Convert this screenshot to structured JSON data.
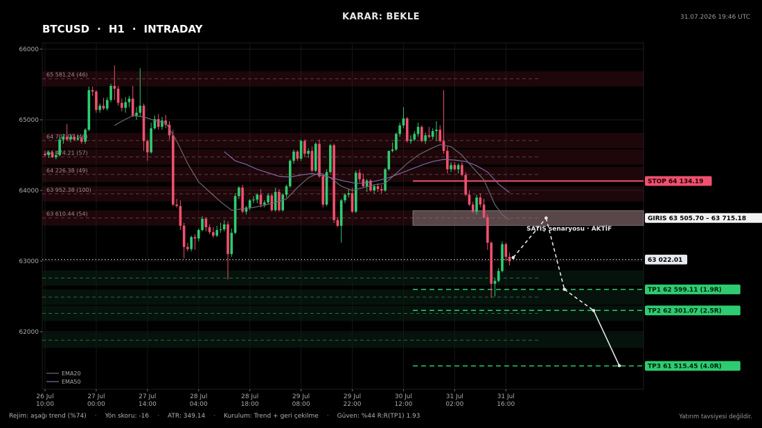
{
  "header": {
    "decision": "KARAR: BEKLE",
    "symbol": "BTCUSD",
    "timeframe": "H1",
    "mode": "INTRADAY",
    "separator": "·",
    "timestamp": "31.07.2026 19:46 UTC"
  },
  "footer": {
    "regime": "Rejim: aşağı trend (%74)",
    "direction": "Yön skoru: -16",
    "atr": "ATR: 349.14",
    "setup": "Kurulum: Trend + geri çekilme",
    "confidence": "Güven: %44   R:R(TP1) 1.93",
    "separator": "·",
    "disclaimer": "Yatırım tavsiyesi değildir."
  },
  "chart_data": {
    "type": "candlestick",
    "y_ticks": [
      62000,
      63000,
      64000,
      65000,
      66000
    ],
    "ylim": [
      61150,
      66100
    ],
    "x_ticks": [
      {
        "index": 0,
        "label": "26 Jul\n10:00"
      },
      {
        "index": 14,
        "label": "27 Jul\n00:00"
      },
      {
        "index": 28,
        "label": "27 Jul\n14:00"
      },
      {
        "index": 42,
        "label": "28 Jul\n04:00"
      },
      {
        "index": 56,
        "label": "28 Jul\n18:00"
      },
      {
        "index": 70,
        "label": "29 Jul\n08:00"
      },
      {
        "index": 84,
        "label": "29 Jul\n22:00"
      },
      {
        "index": 98,
        "label": "30 Jul\n12:00"
      },
      {
        "index": 112,
        "label": "31 Jul\n02:00"
      },
      {
        "index": 126,
        "label": "31 Jul\n16:00"
      }
    ],
    "colors": {
      "up": "#2ecc71",
      "down": "#f0506e",
      "ema20": "#6a6a72",
      "ema50": "#7a6aa0"
    },
    "legend": [
      {
        "name": "EMA20",
        "color": "#6a6a72"
      },
      {
        "name": "EMA50",
        "color": "#7a6aa0"
      }
    ],
    "resistance_levels": [
      {
        "price": 65581.24,
        "label": "65 581.24  (46)"
      },
      {
        "price": 64707.0,
        "label": "64 707.00  (46)"
      },
      {
        "price": 64474.21,
        "label": "64 474.21  (57)"
      },
      {
        "price": 64226.38,
        "label": "64 226.38  (49)"
      },
      {
        "price": 63952.38,
        "label": "63 952.38  (100)"
      },
      {
        "price": 63610.44,
        "label": "63 610.44  (54)"
      }
    ],
    "support_levels": [
      62760,
      62490,
      62260,
      61880
    ],
    "trade": {
      "scenario_label": "SATIŞ senaryosu  ·  AKTİF",
      "stop": {
        "price": 64134.19,
        "label": "STOP  64 134.19"
      },
      "entry": {
        "low": 63505.7,
        "high": 63715.18,
        "label": "GIRIS  63 505.70 – 63 715.18"
      },
      "current": {
        "price": 63022.01,
        "label": "63 022.01"
      },
      "targets": [
        {
          "price": 62599.11,
          "label": "TP1  62 599.11  (1.9R)"
        },
        {
          "price": 62301.07,
          "label": "TP2  62 301.07  (2.5R)"
        },
        {
          "price": 61515.45,
          "label": "TP3  61 515.45  (4.0R)"
        }
      ],
      "path": [
        {
          "index": 128,
          "price": 63050
        },
        {
          "index": 137,
          "price": 63610
        },
        {
          "index": 142,
          "price": 62600
        },
        {
          "index": 150,
          "price": 62300
        },
        {
          "index": 157,
          "price": 61520
        }
      ]
    },
    "candles": [
      {
        "o": 64520,
        "h": 64560,
        "l": 64480,
        "c": 64500
      },
      {
        "o": 64500,
        "h": 64560,
        "l": 64460,
        "c": 64540
      },
      {
        "o": 64540,
        "h": 64570,
        "l": 64460,
        "c": 64470
      },
      {
        "o": 64470,
        "h": 64560,
        "l": 64440,
        "c": 64500
      },
      {
        "o": 64500,
        "h": 64760,
        "l": 64480,
        "c": 64720
      },
      {
        "o": 64720,
        "h": 64800,
        "l": 64660,
        "c": 64760
      },
      {
        "o": 64760,
        "h": 64940,
        "l": 64700,
        "c": 64720
      },
      {
        "o": 64720,
        "h": 64800,
        "l": 64680,
        "c": 64760
      },
      {
        "o": 64760,
        "h": 64800,
        "l": 64700,
        "c": 64720
      },
      {
        "o": 64720,
        "h": 64790,
        "l": 64700,
        "c": 64740
      },
      {
        "o": 64740,
        "h": 64760,
        "l": 64660,
        "c": 64690
      },
      {
        "o": 64690,
        "h": 64880,
        "l": 64660,
        "c": 64860
      },
      {
        "o": 64860,
        "h": 65470,
        "l": 64840,
        "c": 65420
      },
      {
        "o": 65420,
        "h": 65470,
        "l": 65340,
        "c": 65400
      },
      {
        "o": 65400,
        "h": 65420,
        "l": 65100,
        "c": 65140
      },
      {
        "o": 65140,
        "h": 65230,
        "l": 65100,
        "c": 65200
      },
      {
        "o": 65200,
        "h": 65310,
        "l": 65140,
        "c": 65160
      },
      {
        "o": 65160,
        "h": 65320,
        "l": 65130,
        "c": 65280
      },
      {
        "o": 65280,
        "h": 65510,
        "l": 65250,
        "c": 65480
      },
      {
        "o": 65480,
        "h": 65770,
        "l": 65280,
        "c": 65440
      },
      {
        "o": 65440,
        "h": 65480,
        "l": 65200,
        "c": 65240
      },
      {
        "o": 65240,
        "h": 65300,
        "l": 65120,
        "c": 65170
      },
      {
        "o": 65170,
        "h": 65320,
        "l": 65100,
        "c": 65250
      },
      {
        "o": 65250,
        "h": 65340,
        "l": 65180,
        "c": 65300
      },
      {
        "o": 65300,
        "h": 65480,
        "l": 65040,
        "c": 65060
      },
      {
        "o": 65060,
        "h": 65180,
        "l": 65000,
        "c": 65100
      },
      {
        "o": 65100,
        "h": 65730,
        "l": 65040,
        "c": 65200
      },
      {
        "o": 65200,
        "h": 65230,
        "l": 64560,
        "c": 64700
      },
      {
        "o": 64700,
        "h": 64720,
        "l": 64420,
        "c": 64540
      },
      {
        "o": 64540,
        "h": 64960,
        "l": 64520,
        "c": 64880
      },
      {
        "o": 64880,
        "h": 65060,
        "l": 64860,
        "c": 65010
      },
      {
        "o": 65010,
        "h": 65080,
        "l": 64860,
        "c": 64900
      },
      {
        "o": 64900,
        "h": 65040,
        "l": 64860,
        "c": 64990
      },
      {
        "o": 64990,
        "h": 65070,
        "l": 64880,
        "c": 64930
      },
      {
        "o": 64930,
        "h": 64980,
        "l": 64720,
        "c": 64780
      },
      {
        "o": 64780,
        "h": 64860,
        "l": 63780,
        "c": 63800
      },
      {
        "o": 63800,
        "h": 63880,
        "l": 63760,
        "c": 63780
      },
      {
        "o": 63780,
        "h": 63860,
        "l": 63440,
        "c": 63500
      },
      {
        "o": 63500,
        "h": 63540,
        "l": 63040,
        "c": 63200
      },
      {
        "o": 63200,
        "h": 63260,
        "l": 63140,
        "c": 63170
      },
      {
        "o": 63170,
        "h": 63360,
        "l": 63140,
        "c": 63340
      },
      {
        "o": 63340,
        "h": 63380,
        "l": 63160,
        "c": 63320
      },
      {
        "o": 63320,
        "h": 63460,
        "l": 63280,
        "c": 63440
      },
      {
        "o": 63440,
        "h": 63640,
        "l": 63420,
        "c": 63600
      },
      {
        "o": 63600,
        "h": 63620,
        "l": 63420,
        "c": 63480
      },
      {
        "o": 63480,
        "h": 63520,
        "l": 63380,
        "c": 63410
      },
      {
        "o": 63410,
        "h": 63480,
        "l": 63330,
        "c": 63360
      },
      {
        "o": 63360,
        "h": 63500,
        "l": 63340,
        "c": 63440
      },
      {
        "o": 63440,
        "h": 63540,
        "l": 63400,
        "c": 63450
      },
      {
        "o": 63450,
        "h": 63580,
        "l": 63420,
        "c": 63520
      },
      {
        "o": 63520,
        "h": 63560,
        "l": 62740,
        "c": 63100
      },
      {
        "o": 63100,
        "h": 63460,
        "l": 63060,
        "c": 63400
      },
      {
        "o": 63400,
        "h": 63960,
        "l": 63380,
        "c": 63920
      },
      {
        "o": 63920,
        "h": 64060,
        "l": 63880,
        "c": 64040
      },
      {
        "o": 64040,
        "h": 64080,
        "l": 63680,
        "c": 63700
      },
      {
        "o": 63700,
        "h": 63780,
        "l": 63660,
        "c": 63760
      },
      {
        "o": 63760,
        "h": 63880,
        "l": 63720,
        "c": 63860
      },
      {
        "o": 63860,
        "h": 63920,
        "l": 63820,
        "c": 63870
      },
      {
        "o": 63870,
        "h": 63960,
        "l": 63820,
        "c": 63940
      },
      {
        "o": 63940,
        "h": 64020,
        "l": 63760,
        "c": 63800
      },
      {
        "o": 63800,
        "h": 63860,
        "l": 63760,
        "c": 63830
      },
      {
        "o": 63830,
        "h": 63960,
        "l": 63800,
        "c": 63930
      },
      {
        "o": 63930,
        "h": 63960,
        "l": 63700,
        "c": 63720
      },
      {
        "o": 63720,
        "h": 64040,
        "l": 63700,
        "c": 63980
      },
      {
        "o": 63980,
        "h": 64020,
        "l": 63700,
        "c": 63720
      },
      {
        "o": 63720,
        "h": 63960,
        "l": 63700,
        "c": 63940
      },
      {
        "o": 63940,
        "h": 64080,
        "l": 63900,
        "c": 64060
      },
      {
        "o": 64060,
        "h": 64440,
        "l": 64040,
        "c": 64420
      },
      {
        "o": 64420,
        "h": 64580,
        "l": 64380,
        "c": 64550
      },
      {
        "o": 64550,
        "h": 64570,
        "l": 64420,
        "c": 64450
      },
      {
        "o": 64450,
        "h": 64720,
        "l": 64420,
        "c": 64700
      },
      {
        "o": 64700,
        "h": 64720,
        "l": 64480,
        "c": 64520
      },
      {
        "o": 64520,
        "h": 64600,
        "l": 64460,
        "c": 64560
      },
      {
        "o": 64560,
        "h": 64620,
        "l": 64260,
        "c": 64280
      },
      {
        "o": 64280,
        "h": 64680,
        "l": 64260,
        "c": 64660
      },
      {
        "o": 64660,
        "h": 64720,
        "l": 64180,
        "c": 64200
      },
      {
        "o": 64200,
        "h": 64240,
        "l": 63760,
        "c": 63800
      },
      {
        "o": 63800,
        "h": 64300,
        "l": 63780,
        "c": 64260
      },
      {
        "o": 64260,
        "h": 64660,
        "l": 64240,
        "c": 64640
      },
      {
        "o": 64640,
        "h": 64660,
        "l": 63540,
        "c": 63580
      },
      {
        "o": 63580,
        "h": 63620,
        "l": 63480,
        "c": 63500
      },
      {
        "o": 63500,
        "h": 63880,
        "l": 63260,
        "c": 63860
      },
      {
        "o": 63860,
        "h": 63960,
        "l": 63820,
        "c": 63940
      },
      {
        "o": 63940,
        "h": 64020,
        "l": 63900,
        "c": 63960
      },
      {
        "o": 63960,
        "h": 64040,
        "l": 63680,
        "c": 63700
      },
      {
        "o": 63700,
        "h": 64280,
        "l": 63680,
        "c": 64250
      },
      {
        "o": 64250,
        "h": 64300,
        "l": 64120,
        "c": 64160
      },
      {
        "o": 64160,
        "h": 64240,
        "l": 64040,
        "c": 64060
      },
      {
        "o": 64060,
        "h": 64160,
        "l": 63980,
        "c": 64140
      },
      {
        "o": 64140,
        "h": 64160,
        "l": 63980,
        "c": 64000
      },
      {
        "o": 64000,
        "h": 64080,
        "l": 63960,
        "c": 64060
      },
      {
        "o": 64060,
        "h": 64100,
        "l": 63980,
        "c": 64020
      },
      {
        "o": 64020,
        "h": 64080,
        "l": 63960,
        "c": 64000
      },
      {
        "o": 64000,
        "h": 64320,
        "l": 63980,
        "c": 64300
      },
      {
        "o": 64300,
        "h": 64560,
        "l": 64280,
        "c": 64560
      },
      {
        "o": 64560,
        "h": 64680,
        "l": 64540,
        "c": 64580
      },
      {
        "o": 64580,
        "h": 64820,
        "l": 64560,
        "c": 64800
      },
      {
        "o": 64800,
        "h": 64960,
        "l": 64760,
        "c": 64920
      },
      {
        "o": 64920,
        "h": 65180,
        "l": 64880,
        "c": 65020
      },
      {
        "o": 65020,
        "h": 65040,
        "l": 64680,
        "c": 64700
      },
      {
        "o": 64700,
        "h": 64780,
        "l": 64660,
        "c": 64720
      },
      {
        "o": 64720,
        "h": 64840,
        "l": 64700,
        "c": 64800
      },
      {
        "o": 64800,
        "h": 64960,
        "l": 64760,
        "c": 64900
      },
      {
        "o": 64900,
        "h": 64920,
        "l": 64680,
        "c": 64700
      },
      {
        "o": 64700,
        "h": 64820,
        "l": 64660,
        "c": 64780
      },
      {
        "o": 64780,
        "h": 64900,
        "l": 64740,
        "c": 64760
      },
      {
        "o": 64760,
        "h": 64880,
        "l": 64720,
        "c": 64840
      },
      {
        "o": 64840,
        "h": 64980,
        "l": 64700,
        "c": 64860
      },
      {
        "o": 64860,
        "h": 64920,
        "l": 64680,
        "c": 64700
      },
      {
        "o": 64700,
        "h": 65420,
        "l": 64520,
        "c": 64560
      },
      {
        "o": 64560,
        "h": 64620,
        "l": 64240,
        "c": 64300
      },
      {
        "o": 64300,
        "h": 64400,
        "l": 64260,
        "c": 64360
      },
      {
        "o": 64360,
        "h": 64400,
        "l": 64280,
        "c": 64300
      },
      {
        "o": 64300,
        "h": 64380,
        "l": 64240,
        "c": 64360
      },
      {
        "o": 64360,
        "h": 64400,
        "l": 64200,
        "c": 64220
      },
      {
        "o": 64220,
        "h": 64260,
        "l": 63920,
        "c": 63940
      },
      {
        "o": 63940,
        "h": 64000,
        "l": 63780,
        "c": 63800
      },
      {
        "o": 63800,
        "h": 63840,
        "l": 63680,
        "c": 63700
      },
      {
        "o": 63700,
        "h": 63940,
        "l": 63660,
        "c": 63900
      },
      {
        "o": 63900,
        "h": 63960,
        "l": 63760,
        "c": 63800
      },
      {
        "o": 63800,
        "h": 63880,
        "l": 63600,
        "c": 63620
      },
      {
        "o": 63620,
        "h": 63660,
        "l": 63160,
        "c": 63260
      },
      {
        "o": 63260,
        "h": 63280,
        "l": 62480,
        "c": 62680
      },
      {
        "o": 62680,
        "h": 62760,
        "l": 62500,
        "c": 62720
      },
      {
        "o": 62720,
        "h": 62900,
        "l": 62700,
        "c": 62860
      },
      {
        "o": 62860,
        "h": 63280,
        "l": 62840,
        "c": 63240
      },
      {
        "o": 63240,
        "h": 63260,
        "l": 63000,
        "c": 63060
      },
      {
        "o": 63060,
        "h": 63120,
        "l": 62940,
        "c": 63000
      }
    ],
    "ema20": [
      {
        "index": 19,
        "price": 64920
      },
      {
        "index": 21,
        "price": 64980
      },
      {
        "index": 24,
        "price": 65060
      },
      {
        "index": 27,
        "price": 65040
      },
      {
        "index": 30,
        "price": 64990
      },
      {
        "index": 33,
        "price": 64960
      },
      {
        "index": 36,
        "price": 64700
      },
      {
        "index": 39,
        "price": 64380
      },
      {
        "index": 42,
        "price": 64120
      },
      {
        "index": 45,
        "price": 63980
      },
      {
        "index": 48,
        "price": 63840
      },
      {
        "index": 51,
        "price": 63720
      },
      {
        "index": 54,
        "price": 63740
      },
      {
        "index": 57,
        "price": 63760
      },
      {
        "index": 60,
        "price": 63790
      },
      {
        "index": 63,
        "price": 63830
      },
      {
        "index": 66,
        "price": 63880
      },
      {
        "index": 69,
        "price": 64040
      },
      {
        "index": 72,
        "price": 64180
      },
      {
        "index": 75,
        "price": 64250
      },
      {
        "index": 78,
        "price": 64180
      },
      {
        "index": 81,
        "price": 64060
      },
      {
        "index": 84,
        "price": 64000
      },
      {
        "index": 87,
        "price": 64040
      },
      {
        "index": 90,
        "price": 64080
      },
      {
        "index": 93,
        "price": 64100
      },
      {
        "index": 96,
        "price": 64240
      },
      {
        "index": 99,
        "price": 64380
      },
      {
        "index": 102,
        "price": 64500
      },
      {
        "index": 105,
        "price": 64580
      },
      {
        "index": 108,
        "price": 64650
      },
      {
        "index": 111,
        "price": 64620
      },
      {
        "index": 114,
        "price": 64500
      },
      {
        "index": 117,
        "price": 64320
      },
      {
        "index": 120,
        "price": 64150
      },
      {
        "index": 123,
        "price": 63800
      },
      {
        "index": 125,
        "price": 63660
      },
      {
        "index": 127,
        "price": 63580
      }
    ],
    "ema50": [
      {
        "index": 49,
        "price": 64550
      },
      {
        "index": 52,
        "price": 64420
      },
      {
        "index": 55,
        "price": 64370
      },
      {
        "index": 58,
        "price": 64300
      },
      {
        "index": 61,
        "price": 64250
      },
      {
        "index": 64,
        "price": 64200
      },
      {
        "index": 67,
        "price": 64190
      },
      {
        "index": 70,
        "price": 64220
      },
      {
        "index": 73,
        "price": 64240
      },
      {
        "index": 76,
        "price": 64210
      },
      {
        "index": 79,
        "price": 64170
      },
      {
        "index": 82,
        "price": 64130
      },
      {
        "index": 85,
        "price": 64100
      },
      {
        "index": 88,
        "price": 64110
      },
      {
        "index": 91,
        "price": 64140
      },
      {
        "index": 94,
        "price": 64180
      },
      {
        "index": 97,
        "price": 64240
      },
      {
        "index": 100,
        "price": 64300
      },
      {
        "index": 103,
        "price": 64360
      },
      {
        "index": 106,
        "price": 64410
      },
      {
        "index": 109,
        "price": 64440
      },
      {
        "index": 112,
        "price": 64430
      },
      {
        "index": 115,
        "price": 64410
      },
      {
        "index": 118,
        "price": 64350
      },
      {
        "index": 121,
        "price": 64260
      },
      {
        "index": 124,
        "price": 64090
      },
      {
        "index": 127,
        "price": 63970
      }
    ]
  }
}
